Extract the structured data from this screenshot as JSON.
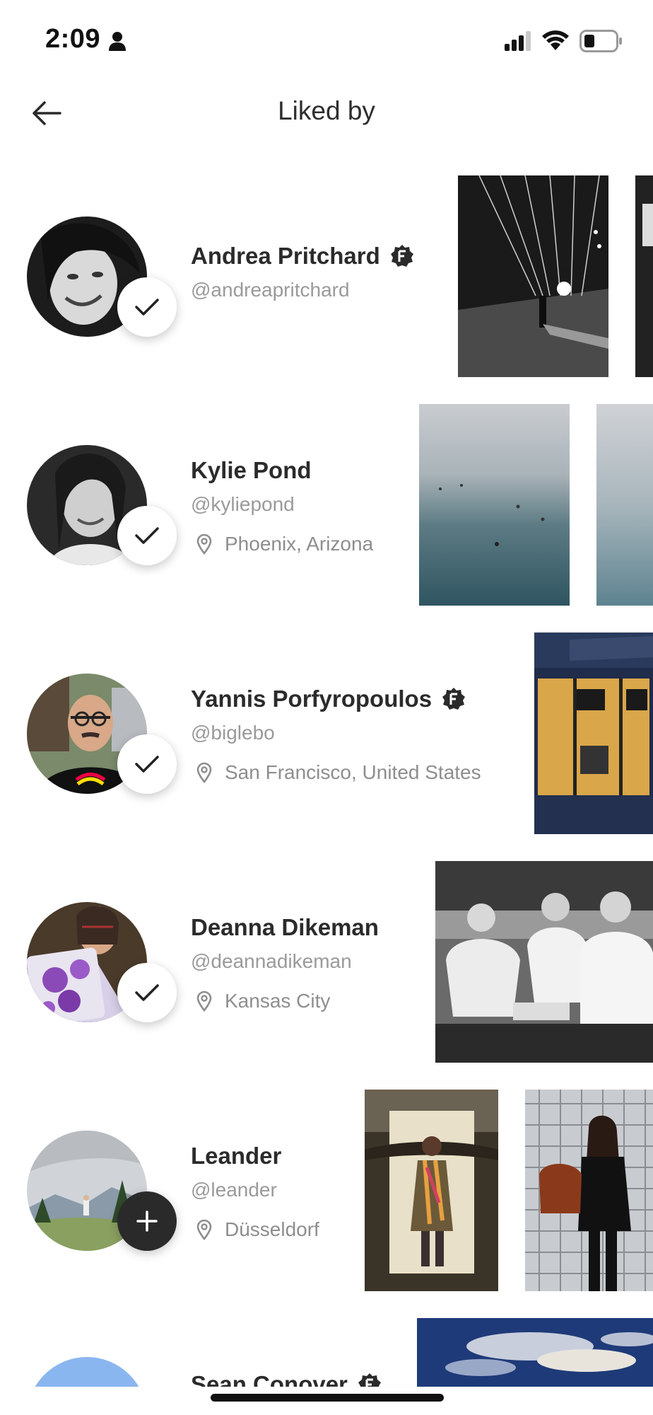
{
  "status_bar": {
    "time": "2:09"
  },
  "header": {
    "title": "Liked by"
  },
  "users": [
    {
      "name": "Andrea Pritchard",
      "handle": "@andreapritchard",
      "location": "",
      "verified": true,
      "follow_state": "following"
    },
    {
      "name": "Kylie Pond",
      "handle": "@kyliepond",
      "location": "Phoenix, Arizona",
      "verified": false,
      "follow_state": "following"
    },
    {
      "name": "Yannis Porfyropoulos",
      "handle": "@biglebo",
      "location": "San Francisco, United States",
      "verified": true,
      "follow_state": "following"
    },
    {
      "name": "Deanna Dikeman",
      "handle": "@deannadikeman",
      "location": "Kansas City",
      "verified": false,
      "follow_state": "following"
    },
    {
      "name": "Leander",
      "handle": "@leander",
      "location": "Düsseldorf",
      "verified": false,
      "follow_state": "follow"
    },
    {
      "name": "Sean Conover",
      "handle": "",
      "location": "",
      "verified": true,
      "follow_state": ""
    }
  ],
  "icons": {
    "back": "arrow-left-icon",
    "verified": "verified-badge-icon",
    "location": "map-pin-icon",
    "following": "checkmark-icon",
    "follow": "plus-icon"
  },
  "colors": {
    "text": "#2b2b2b",
    "secondary": "#9a9a9a",
    "follow_button": "#2a2a2a"
  }
}
